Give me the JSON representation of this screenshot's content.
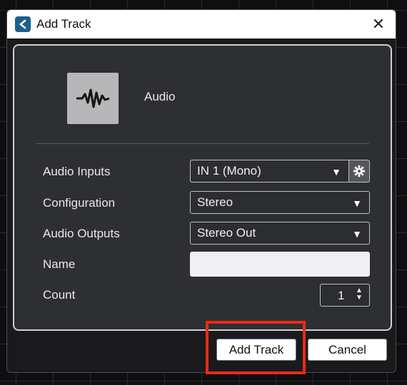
{
  "window": {
    "title": "Add Track",
    "app_icon": "cubase-logo-icon",
    "close_glyph": "✕"
  },
  "track": {
    "type_label": "Audio",
    "icon": "audio-waveform-icon"
  },
  "form": {
    "audio_inputs": {
      "label": "Audio Inputs",
      "value": "IN 1 (Mono)"
    },
    "configuration": {
      "label": "Configuration",
      "value": "Stereo"
    },
    "audio_outputs": {
      "label": "Audio Outputs",
      "value": "Stereo Out"
    },
    "name": {
      "label": "Name",
      "value": ""
    },
    "count": {
      "label": "Count",
      "value": "1"
    }
  },
  "buttons": {
    "add_track": "Add Track",
    "cancel": "Cancel"
  },
  "colors": {
    "highlight": "#ea2a16",
    "panel": "#2e2f33"
  }
}
